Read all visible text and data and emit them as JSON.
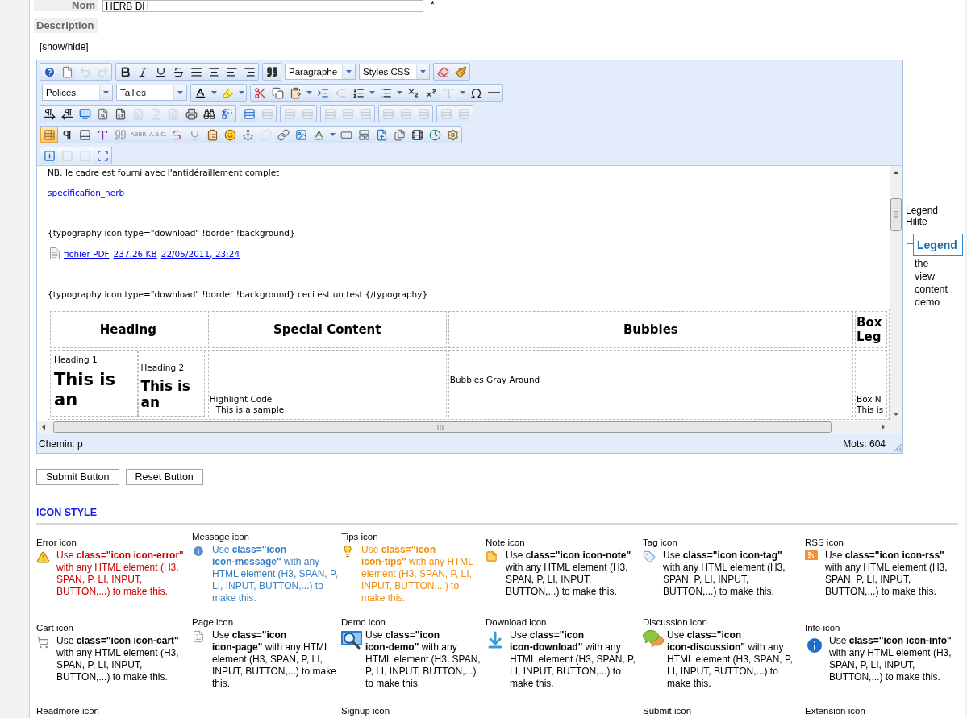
{
  "name_field": {
    "label": "Nom",
    "value": "HERB DH",
    "mark": "*"
  },
  "description_field": {
    "label": "Description",
    "toggle": "[show/hide]"
  },
  "editor": {
    "toolbar": [
      [
        [
          {
            "kind": "help",
            "disabled": false,
            "active": false
          },
          {
            "kind": "new",
            "disabled": false,
            "active": false
          },
          {
            "kind": "undo",
            "disabled": true,
            "active": false
          },
          {
            "kind": "redo",
            "disabled": true,
            "active": false
          }
        ],
        [
          {
            "kind": "bold",
            "disabled": false,
            "active": false
          },
          {
            "kind": "italic",
            "disabled": false,
            "active": false
          },
          {
            "kind": "underline",
            "disabled": false,
            "active": false
          },
          {
            "kind": "strikethrough",
            "disabled": false,
            "active": false
          },
          {
            "kind": "justify",
            "disabled": false,
            "active": false
          },
          {
            "kind": "center",
            "disabled": false,
            "active": false
          },
          {
            "kind": "left",
            "disabled": false,
            "active": false
          },
          {
            "kind": "right",
            "disabled": false,
            "active": false
          }
        ],
        [
          {
            "kind": "blockquote",
            "disabled": false,
            "active": false
          }
        ],
        [
          {
            "kind": "select",
            "value": "Paragraphe",
            "disabled": false,
            "active": false
          }
        ],
        [
          {
            "kind": "select",
            "value": "Styles CSS",
            "disabled": false,
            "active": false
          }
        ],
        [
          {
            "kind": "cleanup",
            "disabled": false,
            "active": false
          },
          {
            "kind": "broom",
            "disabled": false,
            "active": false
          }
        ]
      ],
      [
        [
          {
            "kind": "select",
            "value": "Polices",
            "disabled": false,
            "active": false
          }
        ],
        [
          {
            "kind": "select",
            "value": "Tailles",
            "disabled": false,
            "active": false
          }
        ],
        [
          {
            "kind": "forecolor",
            "disabled": false,
            "active": false
          },
          {
            "kind": "arrow",
            "disabled": false,
            "active": false
          },
          {
            "kind": "highlight",
            "disabled": false,
            "active": false
          },
          {
            "kind": "arrow",
            "disabled": false,
            "active": false
          }
        ],
        [
          {
            "kind": "cut",
            "disabled": false,
            "active": false
          },
          {
            "kind": "copy",
            "disabled": false,
            "active": false
          },
          {
            "kind": "paste",
            "disabled": false,
            "active": false
          },
          {
            "kind": "arrow",
            "disabled": false,
            "active": false
          },
          {
            "kind": "indent",
            "disabled": false,
            "active": false
          },
          {
            "kind": "outdent",
            "disabled": true,
            "active": false
          },
          {
            "kind": "numlist",
            "disabled": false,
            "active": false
          },
          {
            "kind": "arrow",
            "disabled": false,
            "active": false
          },
          {
            "kind": "bullist",
            "disabled": false,
            "active": false
          },
          {
            "kind": "arrow",
            "disabled": false,
            "active": false
          },
          {
            "kind": "sub",
            "disabled": false,
            "active": false
          },
          {
            "kind": "sup",
            "disabled": false,
            "active": false
          },
          {
            "kind": "styleprops",
            "disabled": true,
            "active": false
          },
          {
            "kind": "arrow",
            "disabled": false,
            "active": false
          },
          {
            "kind": "charmap",
            "disabled": false,
            "active": false
          },
          {
            "kind": "hr",
            "disabled": false,
            "active": false
          }
        ]
      ],
      [
        [
          {
            "kind": "ltr",
            "disabled": false,
            "active": false
          },
          {
            "kind": "rtl",
            "disabled": false,
            "active": false
          },
          {
            "kind": "fullscreen",
            "disabled": false,
            "active": false
          },
          {
            "kind": "preview",
            "disabled": false,
            "active": false
          },
          {
            "kind": "code",
            "disabled": false,
            "active": false
          },
          {
            "kind": "doc",
            "disabled": true,
            "active": false
          },
          {
            "kind": "doccheck",
            "disabled": true,
            "active": false
          },
          {
            "kind": "doc",
            "disabled": true,
            "active": false
          },
          {
            "kind": "print",
            "disabled": false,
            "active": false
          },
          {
            "kind": "search",
            "disabled": false,
            "active": false
          },
          {
            "kind": "replace",
            "disabled": false,
            "active": false
          }
        ],
        [
          {
            "kind": "table",
            "disabled": false,
            "active": false
          },
          {
            "kind": "table",
            "disabled": true,
            "active": false
          }
        ],
        [
          {
            "kind": "table",
            "disabled": true,
            "active": false
          },
          {
            "kind": "table",
            "disabled": true,
            "active": false
          }
        ],
        [
          {
            "kind": "table",
            "disabled": true,
            "active": false
          },
          {
            "kind": "table",
            "disabled": true,
            "active": false
          },
          {
            "kind": "table",
            "disabled": true,
            "active": false
          }
        ],
        [
          {
            "kind": "table",
            "disabled": true,
            "active": false
          },
          {
            "kind": "table",
            "disabled": true,
            "active": false
          },
          {
            "kind": "table",
            "disabled": true,
            "active": false
          }
        ],
        [
          {
            "kind": "table",
            "disabled": true,
            "active": false
          },
          {
            "kind": "table",
            "disabled": true,
            "active": false
          }
        ]
      ],
      [
        [
          {
            "kind": "visualaid",
            "disabled": false,
            "active": true
          },
          {
            "kind": "showblocks",
            "disabled": false,
            "active": false
          },
          {
            "kind": "pagebreak",
            "disabled": false,
            "active": false
          },
          {
            "kind": "styles",
            "disabled": false,
            "active": false
          },
          {
            "kind": "cite",
            "disabled": false,
            "active": false
          },
          {
            "kind": "text",
            "label": "ABBR",
            "disabled": false,
            "active": false
          },
          {
            "kind": "text",
            "label": "A.B.C.",
            "disabled": false,
            "active": false
          },
          {
            "kind": "del",
            "disabled": false,
            "active": false
          },
          {
            "kind": "ins",
            "disabled": false,
            "active": false
          },
          {
            "kind": "attribs",
            "disabled": false,
            "active": false
          },
          {
            "kind": "emotions",
            "disabled": false,
            "active": false
          },
          {
            "kind": "anchor",
            "disabled": false,
            "active": false
          },
          {
            "kind": "unlink",
            "disabled": true,
            "active": false
          },
          {
            "kind": "link",
            "disabled": false,
            "active": false
          },
          {
            "kind": "image",
            "disabled": false,
            "active": false
          },
          {
            "kind": "spell",
            "disabled": false,
            "active": false
          },
          {
            "kind": "arrow",
            "disabled": false,
            "active": false
          },
          {
            "kind": "nonbreaking",
            "disabled": false,
            "active": false
          },
          {
            "kind": "template",
            "disabled": false,
            "active": false
          },
          {
            "kind": "insertfile",
            "disabled": false,
            "active": false
          },
          {
            "kind": "files",
            "disabled": false,
            "active": false
          },
          {
            "kind": "media",
            "disabled": false,
            "active": false
          },
          {
            "kind": "datetime",
            "disabled": false,
            "active": false
          },
          {
            "kind": "advanced",
            "disabled": false,
            "active": false
          }
        ]
      ],
      [
        [
          {
            "kind": "layer",
            "disabled": false,
            "active": false
          },
          {
            "kind": "square",
            "disabled": true,
            "active": false
          },
          {
            "kind": "square",
            "disabled": true,
            "active": false
          },
          {
            "kind": "absolute",
            "disabled": false,
            "active": false
          }
        ]
      ]
    ],
    "content": {
      "paragraphs": [
        {
          "kind": "text",
          "text": "NB: le cadre est fourni avec l'antidéraillement complet"
        },
        {
          "kind": "link",
          "text": "specificafion_herb"
        },
        {
          "kind": "blank"
        },
        {
          "kind": "text",
          "text": "{typography icon type=\"download\" !border !background}"
        },
        {
          "kind": "file",
          "links": [
            "fichier PDF",
            "237.26 KB",
            "22/05/2011, 23:24"
          ]
        },
        {
          "kind": "blank"
        },
        {
          "kind": "text",
          "text": "{typography icon type=\"download\" !border !background} ceci est un test {/typography}"
        }
      ],
      "table": {
        "columns": [
          "Heading",
          "Special Content",
          "Bubbles",
          "Box Leg"
        ],
        "cells": [
          {
            "kind": "headings",
            "items": [
              {
                "title": "Heading 1",
                "text": "This is an"
              },
              {
                "title": "Heading 2",
                "text": "This is an"
              }
            ]
          },
          {
            "kind": "code",
            "title": "Highlight Code",
            "code": "This is a sample"
          },
          {
            "kind": "bubbles",
            "lines": [
              "Bubbles Gray Around"
            ]
          },
          {
            "kind": "box",
            "lines": [
              "Box N",
              "This is"
            ]
          }
        ]
      }
    },
    "status_bar": {
      "path": "Chemin: p",
      "words": "Mots: 604"
    }
  },
  "legend": {
    "hilite": "Legend Hilite",
    "title": "Legend",
    "text": "the view content demo"
  },
  "buttons": [
    "Submit Button",
    "Reset Button"
  ],
  "icon_style": {
    "heading": "ICON STYLE",
    "rows": [
      [
        {
          "title": "Error icon",
          "kind": "error",
          "color": "#cc0000",
          "text": "Use **class=\"icon icon-error\"** with any HTML element (H3, SPAN, P, LI, INPUT, BUTTON,...) to make this."
        },
        {
          "title": "Message icon",
          "kind": "message",
          "color": "#3a80c0",
          "text": "Use **class=\"icon icon-message\"** with any HTML element (H3, SPAN, P, LI, INPUT, BUTTON,...) to make this."
        },
        {
          "title": "Tips icon",
          "kind": "tips",
          "color": "#ee8e0c",
          "text": "Use **class=\"icon icon-tips\"** with any HTML element (H3, SPAN, P, LI, INPUT, BUTTON,...) to make this."
        },
        {
          "title": "Note icon",
          "kind": "note",
          "color": "#000000",
          "text": "Use **class=\"icon icon-note\"** with any HTML element (H3, SPAN, P, LI, INPUT, BUTTON,...) to make this."
        },
        {
          "title": "Tag icon",
          "kind": "tag",
          "color": "#000000",
          "text": "Use **class=\"icon icon-tag\"** with any HTML element (H3, SPAN, P, LI, INPUT, BUTTON,...) to make this."
        },
        {
          "title": "RSS icon",
          "kind": "rss",
          "color": "#000000",
          "text": "Use **class=\"icon icon-rss\"** with any HTML element (H3, SPAN, P, LI, INPUT, BUTTON,...) to make this."
        }
      ],
      [
        {
          "title": "Cart icon",
          "kind": "cart",
          "color": "#000000",
          "text": "Use **class=\"icon icon-cart\"** with any HTML element (H3, SPAN, P, LI, INPUT, BUTTON,...) to make this."
        },
        {
          "title": "Page icon",
          "kind": "page",
          "color": "#000000",
          "text": "Use **class=\"icon icon-page\"** with any HTML element (H3, SPAN, P, LI, INPUT, BUTTON,...) to make this."
        },
        {
          "title": "Demo icon",
          "kind": "demo",
          "color": "#000000",
          "text": "Use **class=\"icon icon-demo\"** with any HTML element (H3, SPAN, P, LI, INPUT, BUTTON,...) to make this."
        },
        {
          "title": "Download icon",
          "kind": "download",
          "color": "#000000",
          "text": "Use **class=\"icon icon-download\"** with any HTML element (H3, SPAN, P, LI, INPUT, BUTTON,...) to make this."
        },
        {
          "title": "Discussion icon",
          "kind": "discussion",
          "color": "#000000",
          "text": "Use **class=\"icon icon-discussion\"** with any HTML element (H3, SPAN, P, LI, INPUT, BUTTON,...) to make this."
        },
        {
          "title": "Info icon",
          "kind": "info",
          "color": "#000000",
          "text": "Use **class=\"icon icon-info\"** with any HTML element (H3, SPAN, P, LI, INPUT, BUTTON,...) to make this."
        }
      ],
      [
        {
          "title": "Readmore icon"
        },
        null,
        {
          "title": "Signup icon"
        },
        null,
        {
          "title": "Submit icon"
        },
        {
          "title": "Extension icon"
        }
      ]
    ]
  }
}
